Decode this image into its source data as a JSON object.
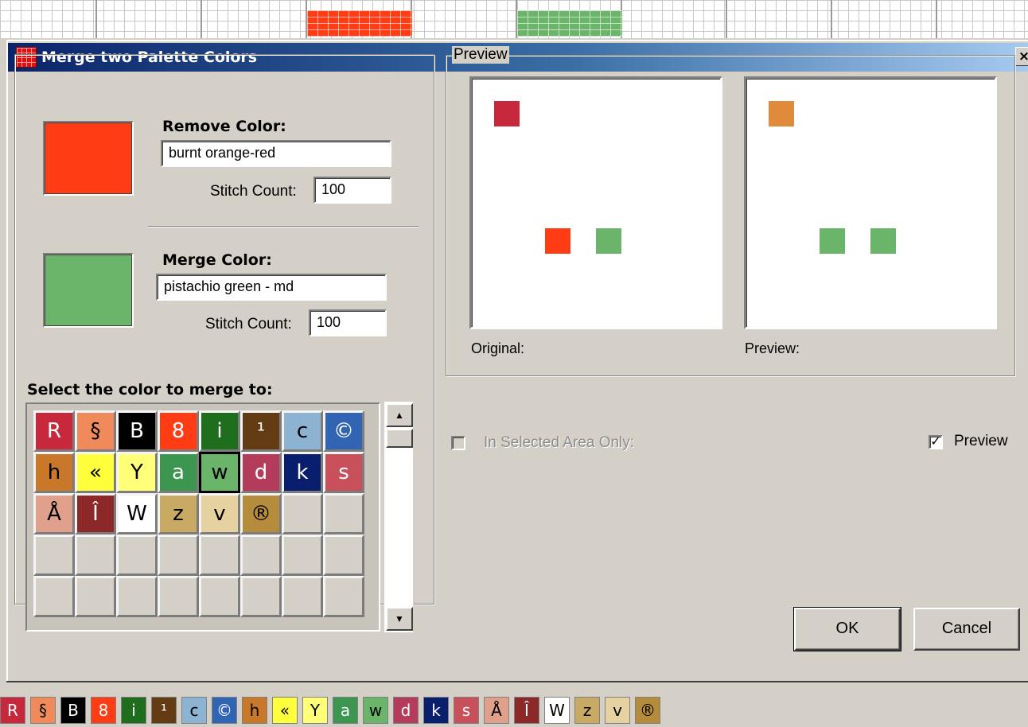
{
  "dialog": {
    "title": "Merge two Palette Colors",
    "close_glyph": "×"
  },
  "remove": {
    "label": "Remove Color:",
    "name": "burnt orange-red",
    "count_label": "Stitch Count:",
    "count": "100",
    "color": "#ff3c14"
  },
  "merge": {
    "label": "Merge Color:",
    "name": "pistachio green - md",
    "count_label": "Stitch Count:",
    "count": "100",
    "color": "#6bb56b"
  },
  "palette": {
    "caption": "Select the color to merge to:",
    "selected_index": 12,
    "cells": [
      {
        "sym": "R",
        "bg": "#c8283c",
        "fg": "#ffffff"
      },
      {
        "sym": "§",
        "bg": "#f08a5a",
        "fg": "#000000"
      },
      {
        "sym": "B",
        "bg": "#000000",
        "fg": "#ffffff"
      },
      {
        "sym": "8",
        "bg": "#ff3c14",
        "fg": "#ffffff"
      },
      {
        "sym": "i",
        "bg": "#1e6e1e",
        "fg": "#ffffff"
      },
      {
        "sym": "¹",
        "bg": "#643c14",
        "fg": "#ffffff"
      },
      {
        "sym": "c",
        "bg": "#8cb4d2",
        "fg": "#000000"
      },
      {
        "sym": "©",
        "bg": "#3264b4",
        "fg": "#ffffff"
      },
      {
        "sym": "h",
        "bg": "#c87828",
        "fg": "#000000"
      },
      {
        "sym": "«",
        "bg": "#ffff3c",
        "fg": "#000000"
      },
      {
        "sym": "Y",
        "bg": "#ffff78",
        "fg": "#000000"
      },
      {
        "sym": "a",
        "bg": "#3c9650",
        "fg": "#ffffff"
      },
      {
        "sym": "w",
        "bg": "#6bb56b",
        "fg": "#000000"
      },
      {
        "sym": "d",
        "bg": "#b43c5a",
        "fg": "#ffffff"
      },
      {
        "sym": "k",
        "bg": "#0a1e6e",
        "fg": "#ffffff"
      },
      {
        "sym": "s",
        "bg": "#c8505a",
        "fg": "#ffffff"
      },
      {
        "sym": "Å",
        "bg": "#e0a08c",
        "fg": "#000000"
      },
      {
        "sym": "Î",
        "bg": "#8c2828",
        "fg": "#ffffff"
      },
      {
        "sym": "W",
        "bg": "#ffffff",
        "fg": "#000000"
      },
      {
        "sym": "z",
        "bg": "#c8aa64",
        "fg": "#000000"
      },
      {
        "sym": "v",
        "bg": "#e6d2a0",
        "fg": "#000000"
      },
      {
        "sym": "®",
        "bg": "#b48c3c",
        "fg": "#000000"
      }
    ],
    "total_cells": 40
  },
  "preview": {
    "legend": "Preview",
    "original_label": "Original:",
    "preview_label": "Preview:",
    "original_pixels": [
      {
        "color": "#c8283c",
        "col": 0,
        "row": 0
      },
      {
        "color": "#ff3c14",
        "col": 2,
        "row": 1
      },
      {
        "color": "#6bb56b",
        "col": 3,
        "row": 1
      }
    ],
    "preview_pixels": [
      {
        "color": "#e08a3c",
        "col": 0,
        "row": 0
      },
      {
        "color": "#6bb56b",
        "col": 2,
        "row": 1
      },
      {
        "color": "#6bb56b",
        "col": 3,
        "row": 1
      }
    ]
  },
  "options": {
    "selected_area_label": "In Selected Area Only:",
    "selected_area_checked": false,
    "selected_area_enabled": false,
    "preview_label": "Preview",
    "preview_checked": true
  },
  "buttons": {
    "ok": "OK",
    "cancel": "Cancel"
  },
  "bottom_strip": {
    "symbols": [
      "R",
      "§",
      "B",
      "8",
      "i",
      "¹",
      "c",
      "©",
      "h",
      "«",
      "Y",
      "a",
      "w",
      "d",
      "k",
      "s",
      "Å",
      "Î",
      "W",
      "z",
      "v",
      "®"
    ]
  }
}
